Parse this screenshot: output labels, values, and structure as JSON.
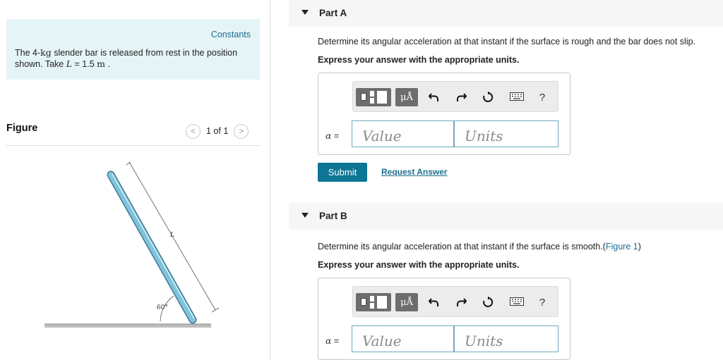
{
  "constants": {
    "link": "Constants",
    "text_pre": "The 4-",
    "unit_kg": "kg",
    "text_mid": " slender bar is released from rest in the position shown. Take ",
    "var_L": "L",
    "text_eq": " = 1.5 ",
    "unit_m": "m",
    "text_end": " ."
  },
  "figure": {
    "title": "Figure",
    "page": "1 of 1",
    "prev": "<",
    "next": ">",
    "label_L": "L",
    "label_angle": "60°"
  },
  "partA": {
    "title": "Part A",
    "question": "Determine its angular acceleration at that instant if the surface is rough and the bar does not slip.",
    "instruction": "Express your answer with the appropriate units.",
    "alpha_symbol": "α",
    "equals": " =",
    "value_placeholder": "Value",
    "units_placeholder": "Units",
    "submit": "Submit",
    "request": "Request Answer"
  },
  "partB": {
    "title": "Part B",
    "question_pre": "Determine its angular acceleration at that instant if the surface is smooth.(",
    "question_link": "Figure 1",
    "question_post": ")",
    "instruction": "Express your answer with the appropriate units.",
    "alpha_symbol": "α",
    "equals": " =",
    "value_placeholder": "Value",
    "units_placeholder": "Units"
  },
  "toolbar": {
    "mu_label": "μÅ",
    "help_label": "?",
    "icons": [
      "template-icon",
      "units-icon",
      "undo-icon",
      "redo-icon",
      "reset-icon",
      "keyboard-icon",
      "help-icon"
    ]
  },
  "colors": {
    "accent": "#0e7595",
    "link": "#1d6f91",
    "constants_bg": "#e5f4f7",
    "bar_fill": "#7fc4dc",
    "field_border": "#6fa9c0"
  }
}
